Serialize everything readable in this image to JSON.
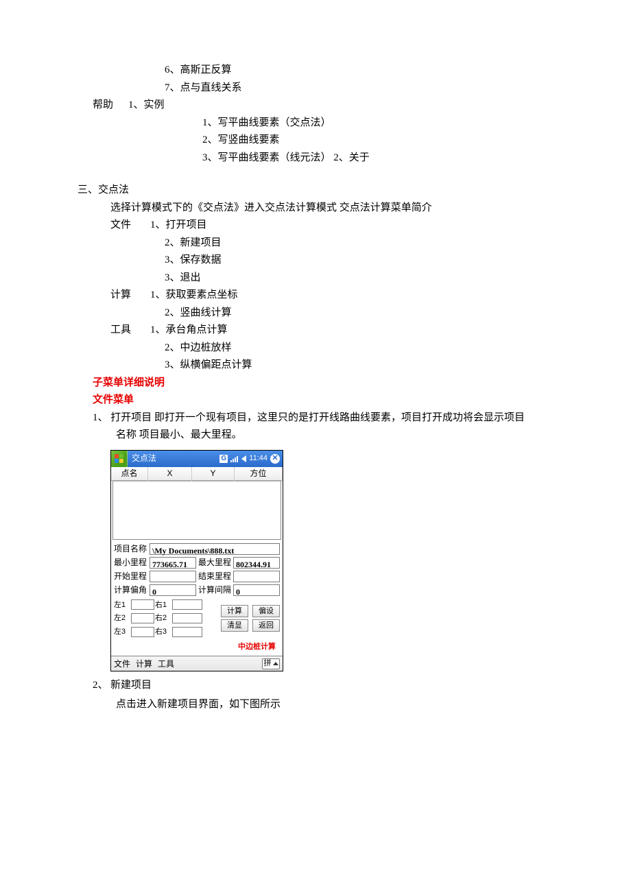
{
  "top_list": {
    "item6": "6、高斯正反算",
    "item7": "7、点与直线关系"
  },
  "help_section": {
    "label": "帮助",
    "item1": "1、实例",
    "sub1": "1、写平曲线要素（交点法）",
    "sub2": "2、写竖曲线要素",
    "sub3": "3、写平曲线要素（线元法）  2、关于"
  },
  "section3": {
    "title": "三、交点法",
    "intro": "选择计算模式下的《交点法》进入交点法计算模式 交点法计算菜单简介",
    "file": {
      "label": "文件",
      "i1": "1、打开项目",
      "i2": "2、新建项目",
      "i3": "3、保存数据",
      "i4": "3、退出"
    },
    "calc": {
      "label": "计算",
      "i1": "1、获取要素点坐标",
      "i2": "2、竖曲线计算"
    },
    "tool": {
      "label": "工具",
      "i1": "1、承台角点计算",
      "i2": "2、中边桩放样",
      "i3": "3、纵横偏距点计算"
    }
  },
  "red_headers": {
    "h1": "子菜单详细说明",
    "h2": "文件菜单"
  },
  "desc1": {
    "line1a": "1、 打开项目 即打开一个现有项目，这里只的是打开线路曲线要素，项目打开成功将会显示项目",
    "line1b": "名称 项目最小、最大里程。"
  },
  "pda": {
    "title": "交点法",
    "time": "11:44",
    "headers": {
      "name": "点名",
      "x": "X",
      "y": "Y",
      "dir": "方位"
    },
    "labels": {
      "projname": "项目名称",
      "minmile": "最小里程",
      "maxmile": "最大里程",
      "startmile": "开始里程",
      "endmile": "结束里程",
      "offset": "计算偏角",
      "offset_val": "0",
      "interval": "计算间隔",
      "interval_val": "0",
      "l1": "左1",
      "l2": "左2",
      "l3": "左3",
      "r1": "右1",
      "r2": "右2",
      "r3": "右3"
    },
    "values": {
      "projname": "\\My Documents\\888.txt",
      "minmile": "773665.71",
      "maxmile": "802344.91"
    },
    "buttons": {
      "calc": "计算",
      "offset": "偏设",
      "clear": "清显",
      "back": "返回"
    },
    "redlabel": "中边桩计算",
    "menu": {
      "file": "文件",
      "calc": "计算",
      "tool": "工具"
    },
    "sip": "拼"
  },
  "desc2": {
    "num": "2、",
    "title": "新建项目",
    "line": "点击进入新建项目界面，如下图所示"
  }
}
